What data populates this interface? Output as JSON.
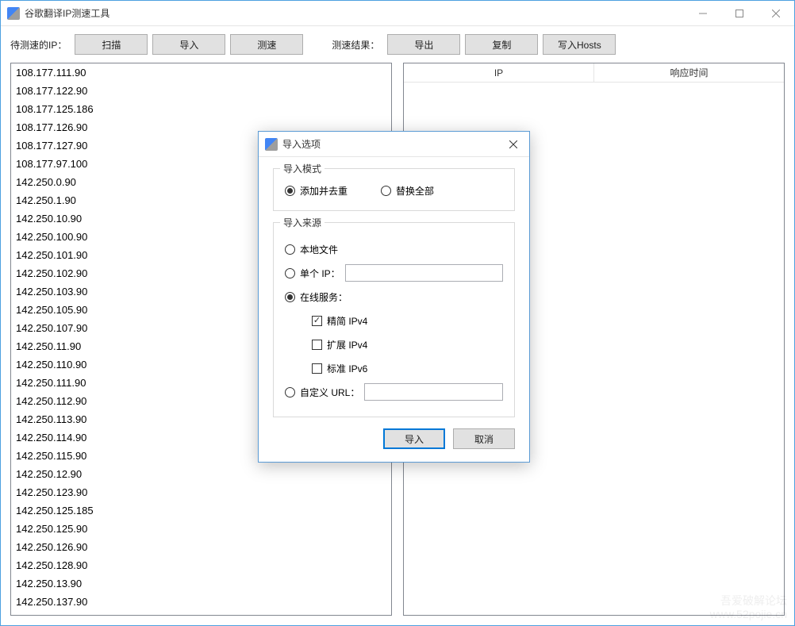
{
  "window": {
    "title": "谷歌翻译IP测速工具"
  },
  "toolbar": {
    "pending_label": "待测速的IP：",
    "scan": "扫描",
    "import": "导入",
    "test": "测速",
    "results_label": "测速结果：",
    "export": "导出",
    "copy": "复制",
    "write_hosts": "写入Hosts"
  },
  "results_header": {
    "ip": "IP",
    "response": "响应时间"
  },
  "ip_list": [
    "108.177.111.90",
    "108.177.122.90",
    "108.177.125.186",
    "108.177.126.90",
    "108.177.127.90",
    "108.177.97.100",
    "142.250.0.90",
    "142.250.1.90",
    "142.250.10.90",
    "142.250.100.90",
    "142.250.101.90",
    "142.250.102.90",
    "142.250.103.90",
    "142.250.105.90",
    "142.250.107.90",
    "142.250.11.90",
    "142.250.110.90",
    "142.250.111.90",
    "142.250.112.90",
    "142.250.113.90",
    "142.250.114.90",
    "142.250.115.90",
    "142.250.12.90",
    "142.250.123.90",
    "142.250.125.185",
    "142.250.125.90",
    "142.250.126.90",
    "142.250.128.90",
    "142.250.13.90",
    "142.250.137.90"
  ],
  "dialog": {
    "title": "导入选项",
    "mode_group": "导入模式",
    "mode_append": "添加并去重",
    "mode_replace": "替换全部",
    "source_group": "导入来源",
    "source_local": "本地文件",
    "source_single": "单个 IP：",
    "source_online": "在线服务：",
    "online_simple_v4": "精简 IPv4",
    "online_ext_v4": "扩展 IPv4",
    "online_std_v6": "标准 IPv6",
    "source_custom": "自定义 URL：",
    "ok": "导入",
    "cancel": "取消"
  },
  "watermark": {
    "line1": "吾爱破解论坛",
    "line2": "www.52pojie.cn"
  }
}
